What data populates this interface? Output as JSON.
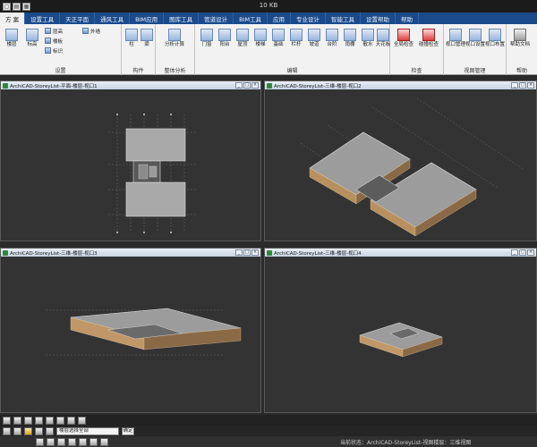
{
  "window": {
    "title": "10 KB",
    "quick_icons": [
      "new-file-icon",
      "open-file-icon",
      "save-file-icon"
    ]
  },
  "menu": {
    "tabs": [
      {
        "label": "方 案"
      },
      {
        "label": "设置工具"
      },
      {
        "label": "天正平面"
      },
      {
        "label": "通风工具"
      },
      {
        "label": "BIM应用"
      },
      {
        "label": "图库工具"
      },
      {
        "label": "管道设计"
      },
      {
        "label": "BIM工具"
      },
      {
        "label": "应用"
      },
      {
        "label": "专业设计"
      },
      {
        "label": "智能工具"
      },
      {
        "label": "设置帮助"
      },
      {
        "label": "帮助"
      }
    ]
  },
  "ribbon": {
    "groups": [
      {
        "label": "设置",
        "buttons": [
          "楼层",
          "标高",
          "层高",
          "楼板",
          "标识",
          "外墙"
        ]
      },
      {
        "label": "构件",
        "buttons": [
          "柱",
          "梁"
        ]
      },
      {
        "label": "整体分析",
        "buttons": [
          "分析计算"
        ]
      },
      {
        "label": "编辑",
        "buttons": [
          "门窗",
          "阳台",
          "屋顶",
          "楼梯",
          "基础",
          "栏杆",
          "坡道",
          "台阶",
          "雨棚",
          "散水",
          "天花板"
        ]
      },
      {
        "label": "检查",
        "buttons": [
          "全局检查",
          "碰撞检查"
        ]
      },
      {
        "label": "视图管理",
        "buttons": [
          "视口管理",
          "视口设置",
          "视口布置"
        ]
      },
      {
        "label": "帮助",
        "buttons": [
          "帮助文档"
        ]
      }
    ]
  },
  "viewports": [
    {
      "title": "ArchiCAD-StoreyList-平面-楼层-视口1"
    },
    {
      "title": "ArchiCAD-StoreyList-三维-楼层-视口2"
    },
    {
      "title": "ArchiCAD-StoreyList-三维-楼层-视口3"
    },
    {
      "title": "ArchiCAD-StoreyList-三维-楼层-视口4"
    }
  ],
  "statusbar": {
    "field_value": "楼层选择全部",
    "field2_value": "确定",
    "status_text": "当前状态：ArchiCAD-StoreyList-视图楼层：三维视图"
  }
}
